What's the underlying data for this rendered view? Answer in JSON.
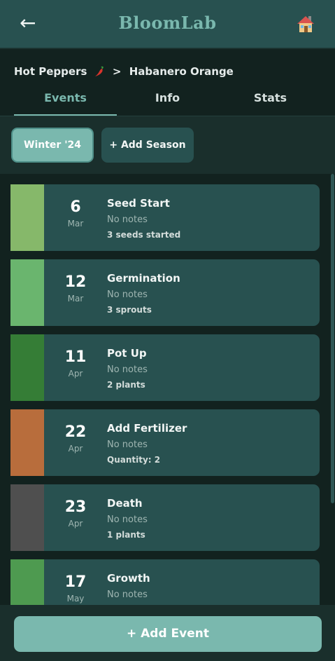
{
  "header": {
    "back_icon": "arrow-left-icon",
    "back_glyph": "←",
    "title": "BloomLab",
    "home_icon": "house-icon"
  },
  "breadcrumb": {
    "category": "Hot Peppers",
    "category_icon": "chili-pepper-icon",
    "separator": ">",
    "variety": "Habanero Orange"
  },
  "tabs": [
    {
      "label": "Events",
      "active": true
    },
    {
      "label": "Info",
      "active": false
    },
    {
      "label": "Stats",
      "active": false
    }
  ],
  "seasons": {
    "selected": "Winter '24",
    "add_label": "+ Add Season"
  },
  "events": [
    {
      "day": "6",
      "month": "Mar",
      "title": "Seed Start",
      "notes": "No notes",
      "detail": "3 seeds started",
      "color": "#86b86a"
    },
    {
      "day": "12",
      "month": "Mar",
      "title": "Germination",
      "notes": "No notes",
      "detail": "3 sprouts",
      "color": "#6ab56e"
    },
    {
      "day": "11",
      "month": "Apr",
      "title": "Pot Up",
      "notes": "No notes",
      "detail": "2 plants",
      "color": "#357d36"
    },
    {
      "day": "22",
      "month": "Apr",
      "title": "Add Fertilizer",
      "notes": "No notes",
      "detail": "Quantity: 2",
      "color": "#b86d3c"
    },
    {
      "day": "23",
      "month": "Apr",
      "title": "Death",
      "notes": "No notes",
      "detail": "1 plants",
      "color": "#4f4f4f"
    },
    {
      "day": "17",
      "month": "May",
      "title": "Growth",
      "notes": "No notes",
      "detail": "",
      "color": "#4e9a50"
    }
  ],
  "footer": {
    "add_event_label": "+ Add Event"
  },
  "colors": {
    "accent": "#7ab8ae",
    "card": "#285150",
    "background": "#12221f"
  }
}
